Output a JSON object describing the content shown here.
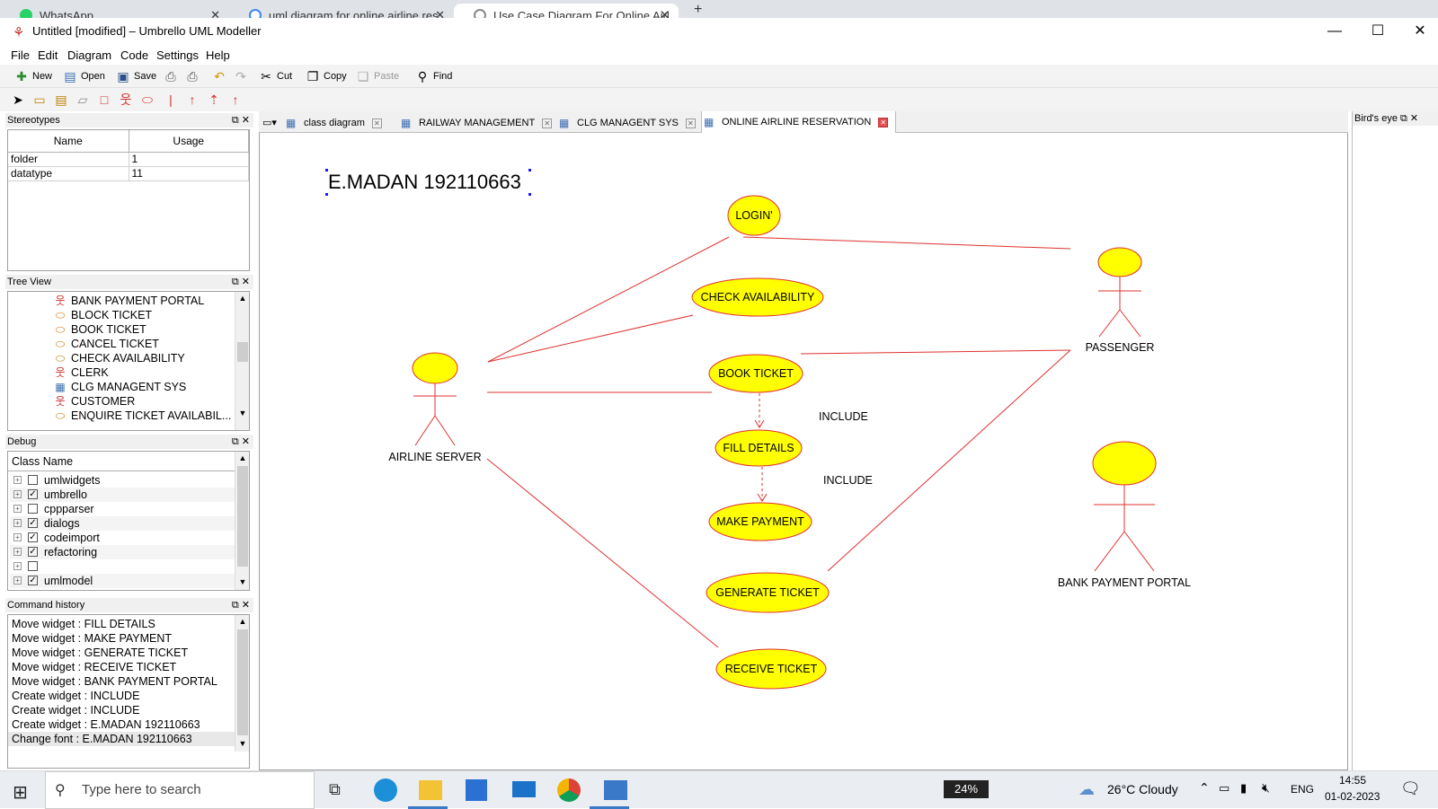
{
  "browser": {
    "tabs": [
      {
        "title": "WhatsApp"
      },
      {
        "title": "uml diagram for online airline res"
      },
      {
        "title": "Use Case Diagram For Online Airl"
      }
    ]
  },
  "window": {
    "title": "Untitled [modified] – Umbrello UML Modeller"
  },
  "menu": [
    "File",
    "Edit",
    "Diagram",
    "Code",
    "Settings",
    "Help"
  ],
  "toolbar": {
    "new": "New",
    "open": "Open",
    "save": "Save",
    "cut": "Cut",
    "copy": "Copy",
    "paste": "Paste",
    "find": "Find"
  },
  "stereotypes": {
    "title": "Stereotypes",
    "columns": [
      "Name",
      "Usage"
    ],
    "rows": [
      {
        "name": "folder",
        "usage": "1"
      },
      {
        "name": "datatype",
        "usage": "11"
      }
    ]
  },
  "tree_view": {
    "title": "Tree View",
    "items": [
      {
        "label": "BANK PAYMENT PORTAL",
        "icon": "actor-icon"
      },
      {
        "label": "BLOCK TICKET",
        "icon": "usecase-icon"
      },
      {
        "label": "BOOK TICKET",
        "icon": "usecase-icon"
      },
      {
        "label": "CANCEL TICKET",
        "icon": "usecase-icon"
      },
      {
        "label": "CHECK AVAILABILITY",
        "icon": "usecase-icon"
      },
      {
        "label": "CLERK",
        "icon": "actor-icon"
      },
      {
        "label": "CLG MANAGENT SYS",
        "icon": "diagram-icon"
      },
      {
        "label": "CUSTOMER",
        "icon": "actor-icon"
      },
      {
        "label": "ENQUIRE TICKET AVAILABIL...",
        "icon": "usecase-icon"
      }
    ]
  },
  "debug": {
    "title": "Debug",
    "column": "Class Name",
    "rows": [
      {
        "label": "umlwidgets",
        "checked": false
      },
      {
        "label": "umbrello",
        "checked": true
      },
      {
        "label": "cppparser",
        "checked": false
      },
      {
        "label": "dialogs",
        "checked": true
      },
      {
        "label": "codeimport",
        "checked": true
      },
      {
        "label": "refactoring",
        "checked": true
      },
      {
        "label": "",
        "checked": false
      },
      {
        "label": "umlmodel",
        "checked": true
      }
    ]
  },
  "command_history": {
    "title": "Command history",
    "items": [
      "Move widget : FILL DETAILS",
      "Move widget : MAKE PAYMENT",
      "Move widget : GENERATE TICKET",
      "Move widget : RECEIVE TICKET",
      "Move widget : BANK PAYMENT PORTAL",
      "Create widget : INCLUDE",
      "Create widget : INCLUDE",
      "Create widget : E.MADAN 192110663",
      "Change font : E.MADAN 192110663"
    ]
  },
  "diagram_tabs": [
    {
      "label": "class diagram"
    },
    {
      "label": "RAILWAY MANAGEMENT"
    },
    {
      "label": "CLG MANAGENT SYS"
    },
    {
      "label": "ONLINE AIRLINE RESERVATION",
      "active": true
    }
  ],
  "birds_eye": {
    "title": "Bird's eye"
  },
  "diagram": {
    "note": "E.MADAN 192110663",
    "usecases": {
      "login": "LOGIN'",
      "check_availability": "CHECK AVAILABILITY",
      "book_ticket": "BOOK TICKET",
      "fill_details": "FILL DETAILS",
      "make_payment": "MAKE PAYMENT",
      "generate_ticket": "GENERATE TICKET",
      "receive_ticket": "RECEIVE TICKET"
    },
    "actors": {
      "airline_server": "AIRLINE SERVER",
      "passenger": "PASSENGER",
      "bank_payment_portal": "BANK PAYMENT PORTAL"
    },
    "include_labels": [
      "INCLUDE",
      "INCLUDE"
    ],
    "colors": {
      "fill": "#ffff00",
      "line": "#e03030",
      "text": "#000000"
    }
  },
  "taskbar": {
    "search_placeholder": "Type here to search",
    "battery": "24%",
    "weather": "26°C  Cloudy",
    "language": "ENG",
    "time": "14:55",
    "date": "01-02-2023"
  }
}
